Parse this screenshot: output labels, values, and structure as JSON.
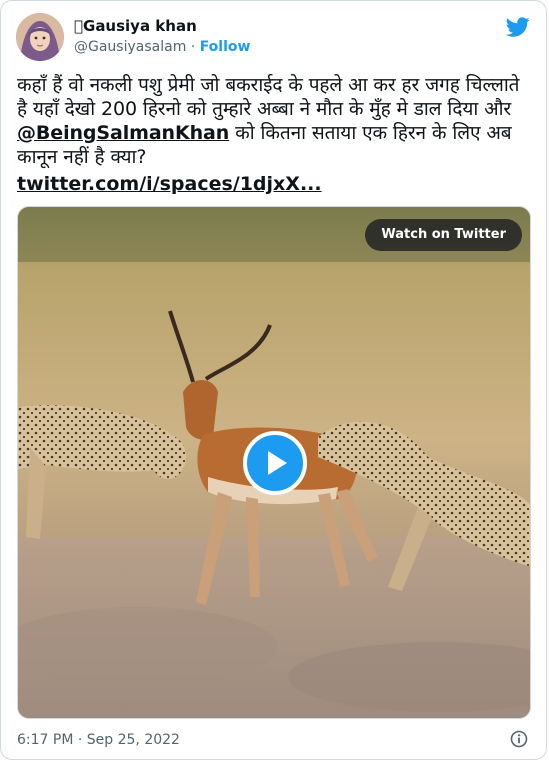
{
  "author": {
    "name": "\u0000Gausiya khan",
    "display_name": "Gausiya khan",
    "handle": "@Gausiyasalam",
    "separator": "·",
    "follow_label": "Follow"
  },
  "tweet": {
    "text_before": "कहाँ हैं वो नकली पशु प्रेमी जो बकराईद के पहले आ कर हर जगह चिल्लाते है यहाँ देखो 200 हिरनो को तुम्हारे अब्बा ने मौत के मुँह मे डाल दिया और ",
    "mention": "@BeingSalmanKhan",
    "text_after": " को कितना सताया एक हिरन के लिए अब कानून नहीं है क्या?",
    "link": "twitter.com/i/spaces/1djxX..."
  },
  "media": {
    "watch_label": "Watch on Twitter",
    "play_icon": "play-icon"
  },
  "footer": {
    "timestamp": "6:17 PM · Sep 25, 2022",
    "info_icon": "info-icon"
  },
  "colors": {
    "accent": "#1d9bf0",
    "text": "#0f1419",
    "muted": "#536471",
    "border": "#cfd9de"
  }
}
